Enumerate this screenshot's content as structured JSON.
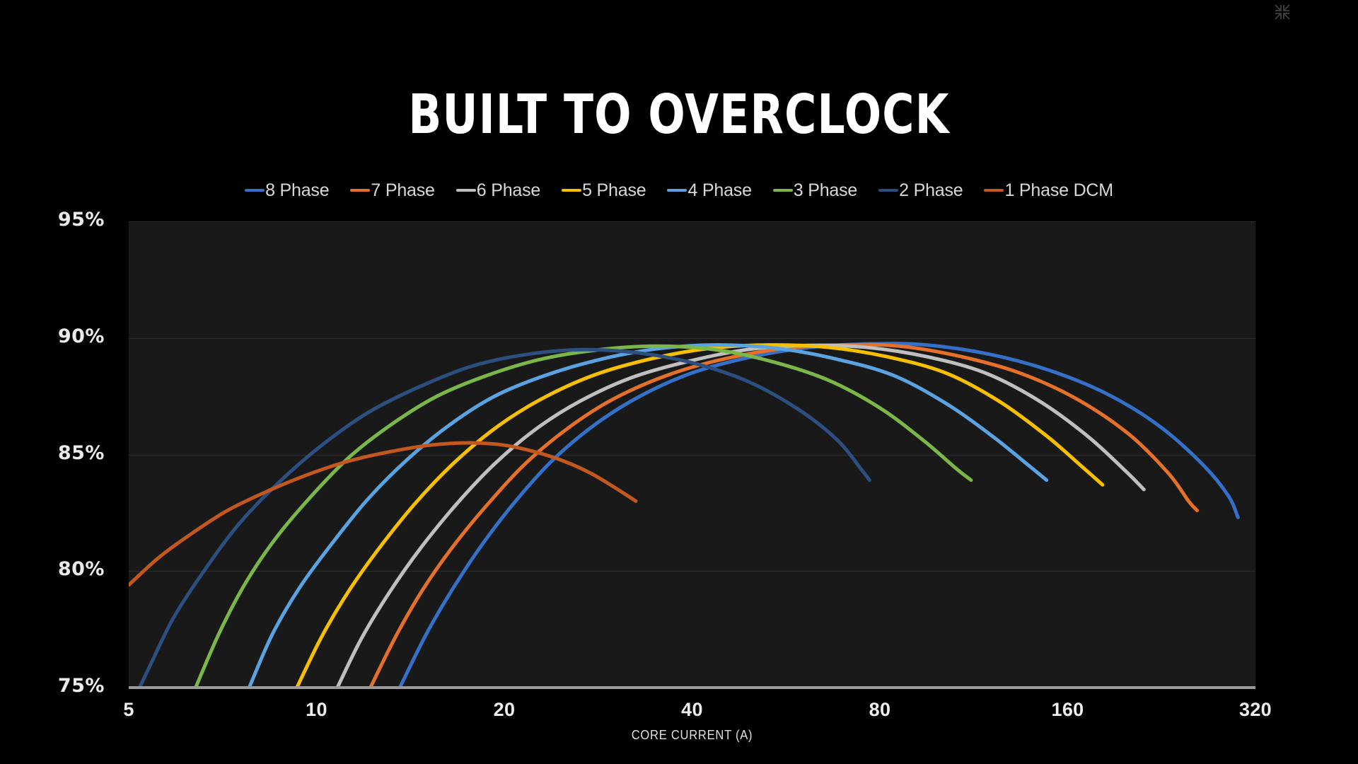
{
  "window": {
    "background_color": "#000000",
    "fullscreen_icon": "exit-fullscreen-icon"
  },
  "header": {
    "title": "BUILT TO OVERCLOCK"
  },
  "legend": {
    "position": "top-center",
    "items": [
      {
        "label": "8 Phase",
        "color": "#3570c8"
      },
      {
        "label": "7 Phase",
        "color": "#e4702a"
      },
      {
        "label": "6 Phase",
        "color": "#bfbfbf"
      },
      {
        "label": "5 Phase",
        "color": "#f6c000"
      },
      {
        "label": "4 Phase",
        "color": "#5aa3e0"
      },
      {
        "label": "3 Phase",
        "color": "#7ab648"
      },
      {
        "label": "2 Phase",
        "color": "#2c4f80"
      },
      {
        "label": "1 Phase DCM",
        "color": "#c2581f"
      }
    ]
  },
  "chart_data": {
    "type": "line",
    "title": "BUILT TO OVERCLOCK",
    "xlabel": "CORE CURRENT (A)",
    "ylabel": "",
    "x_scale": "log2",
    "x_ticks": [
      5,
      10,
      20,
      40,
      80,
      160,
      320
    ],
    "x_tick_labels": [
      "5",
      "10",
      "20",
      "40",
      "80",
      "160",
      "320"
    ],
    "xlim": [
      5,
      320
    ],
    "y_ticks": [
      75,
      80,
      85,
      90,
      95
    ],
    "y_tick_labels": [
      "75%",
      "80%",
      "85%",
      "90%",
      "95%"
    ],
    "ylim": [
      75,
      95
    ],
    "grid": true,
    "grid_axis": "y",
    "plot_background": "#191919",
    "series": [
      {
        "name": "8 Phase",
        "color": "#3570c8",
        "points": [
          [
            13.6,
            75.0
          ],
          [
            15.0,
            77.3
          ],
          [
            16.5,
            79.2
          ],
          [
            18.5,
            81.2
          ],
          [
            21.0,
            83.1
          ],
          [
            24.0,
            84.8
          ],
          [
            28.0,
            86.3
          ],
          [
            33.0,
            87.5
          ],
          [
            40.0,
            88.5
          ],
          [
            50.0,
            89.2
          ],
          [
            62.0,
            89.6
          ],
          [
            78.0,
            89.75
          ],
          [
            95.0,
            89.7
          ],
          [
            120.0,
            89.3
          ],
          [
            150.0,
            88.6
          ],
          [
            185.0,
            87.6
          ],
          [
            225.0,
            86.2
          ],
          [
            265.0,
            84.5
          ],
          [
            290.0,
            83.2
          ],
          [
            300.0,
            82.3
          ]
        ]
      },
      {
        "name": "7 Phase",
        "color": "#e4702a",
        "points": [
          [
            12.2,
            75.0
          ],
          [
            13.4,
            77.2
          ],
          [
            14.8,
            79.2
          ],
          [
            16.6,
            81.1
          ],
          [
            19.0,
            83.0
          ],
          [
            21.8,
            84.7
          ],
          [
            25.5,
            86.2
          ],
          [
            30.0,
            87.4
          ],
          [
            36.5,
            88.4
          ],
          [
            45.0,
            89.1
          ],
          [
            56.0,
            89.55
          ],
          [
            70.0,
            89.7
          ],
          [
            86.0,
            89.65
          ],
          [
            108.0,
            89.2
          ],
          [
            134.0,
            88.5
          ],
          [
            165.0,
            87.4
          ],
          [
            200.0,
            85.9
          ],
          [
            232.0,
            84.2
          ],
          [
            250.0,
            83.0
          ],
          [
            258.0,
            82.6
          ]
        ]
      },
      {
        "name": "6 Phase",
        "color": "#bfbfbf",
        "points": [
          [
            10.8,
            75.0
          ],
          [
            11.8,
            77.1
          ],
          [
            13.1,
            79.1
          ],
          [
            14.7,
            81.0
          ],
          [
            16.8,
            82.9
          ],
          [
            19.3,
            84.6
          ],
          [
            22.5,
            86.1
          ],
          [
            26.5,
            87.3
          ],
          [
            32.0,
            88.3
          ],
          [
            39.5,
            89.0
          ],
          [
            49.0,
            89.5
          ],
          [
            61.0,
            89.68
          ],
          [
            76.0,
            89.6
          ],
          [
            95.0,
            89.2
          ],
          [
            118.0,
            88.5
          ],
          [
            144.0,
            87.3
          ],
          [
            172.0,
            85.8
          ],
          [
            198.0,
            84.3
          ],
          [
            212.0,
            83.5
          ]
        ]
      },
      {
        "name": "5 Phase",
        "color": "#f6c000",
        "points": [
          [
            9.3,
            75.0
          ],
          [
            10.2,
            77.2
          ],
          [
            11.3,
            79.2
          ],
          [
            12.7,
            81.1
          ],
          [
            14.5,
            83.0
          ],
          [
            16.7,
            84.7
          ],
          [
            19.5,
            86.2
          ],
          [
            23.0,
            87.4
          ],
          [
            27.8,
            88.4
          ],
          [
            34.3,
            89.1
          ],
          [
            42.5,
            89.55
          ],
          [
            53.0,
            89.7
          ],
          [
            66.0,
            89.6
          ],
          [
            82.0,
            89.2
          ],
          [
            102.0,
            88.5
          ],
          [
            124.0,
            87.3
          ],
          [
            148.0,
            85.8
          ],
          [
            170.0,
            84.4
          ],
          [
            182.0,
            83.7
          ]
        ]
      },
      {
        "name": "4 Phase",
        "color": "#5aa3e0",
        "points": [
          [
            7.8,
            75.0
          ],
          [
            8.5,
            77.3
          ],
          [
            9.4,
            79.3
          ],
          [
            10.6,
            81.2
          ],
          [
            12.1,
            83.1
          ],
          [
            14.0,
            84.8
          ],
          [
            16.4,
            86.3
          ],
          [
            19.3,
            87.5
          ],
          [
            23.3,
            88.4
          ],
          [
            28.7,
            89.1
          ],
          [
            35.5,
            89.55
          ],
          [
            44.0,
            89.7
          ],
          [
            55.0,
            89.55
          ],
          [
            68.0,
            89.1
          ],
          [
            84.0,
            88.4
          ],
          [
            102.0,
            87.2
          ],
          [
            121.0,
            85.8
          ],
          [
            139.0,
            84.5
          ],
          [
            148.0,
            83.9
          ]
        ]
      },
      {
        "name": "3 Phase",
        "color": "#7ab648",
        "points": [
          [
            6.4,
            75.0
          ],
          [
            7.0,
            77.4
          ],
          [
            7.7,
            79.5
          ],
          [
            8.6,
            81.4
          ],
          [
            9.8,
            83.2
          ],
          [
            11.3,
            84.9
          ],
          [
            13.2,
            86.3
          ],
          [
            15.6,
            87.5
          ],
          [
            18.8,
            88.4
          ],
          [
            23.0,
            89.1
          ],
          [
            28.5,
            89.5
          ],
          [
            35.0,
            89.65
          ],
          [
            43.5,
            89.5
          ],
          [
            53.5,
            89.0
          ],
          [
            66.0,
            88.2
          ],
          [
            80.0,
            87.0
          ],
          [
            94.0,
            85.6
          ],
          [
            106.0,
            84.4
          ],
          [
            112.0,
            83.9
          ]
        ]
      },
      {
        "name": "2 Phase",
        "color": "#2c4f80",
        "points": [
          [
            5.0,
            74.0
          ],
          [
            5.4,
            75.9
          ],
          [
            5.9,
            78.0
          ],
          [
            6.6,
            80.0
          ],
          [
            7.5,
            82.0
          ],
          [
            8.7,
            83.8
          ],
          [
            10.2,
            85.4
          ],
          [
            12.1,
            86.8
          ],
          [
            14.6,
            87.9
          ],
          [
            17.8,
            88.8
          ],
          [
            21.8,
            89.3
          ],
          [
            26.8,
            89.5
          ],
          [
            33.0,
            89.35
          ],
          [
            40.5,
            88.9
          ],
          [
            49.5,
            88.1
          ],
          [
            59.5,
            86.9
          ],
          [
            68.5,
            85.6
          ],
          [
            75.0,
            84.3
          ],
          [
            77.0,
            83.9
          ]
        ]
      },
      {
        "name": "1 Phase DCM",
        "color": "#c2581f",
        "points": [
          [
            5.0,
            79.4
          ],
          [
            5.6,
            80.6
          ],
          [
            6.3,
            81.6
          ],
          [
            7.2,
            82.6
          ],
          [
            8.3,
            83.4
          ],
          [
            9.6,
            84.1
          ],
          [
            11.2,
            84.7
          ],
          [
            13.0,
            85.1
          ],
          [
            15.2,
            85.4
          ],
          [
            17.6,
            85.5
          ],
          [
            20.0,
            85.4
          ],
          [
            22.5,
            85.1
          ],
          [
            25.0,
            84.7
          ],
          [
            27.5,
            84.2
          ],
          [
            30.0,
            83.6
          ],
          [
            32.5,
            83.0
          ]
        ]
      }
    ]
  },
  "axes": {
    "x_title": "CORE CURRENT (A)"
  }
}
